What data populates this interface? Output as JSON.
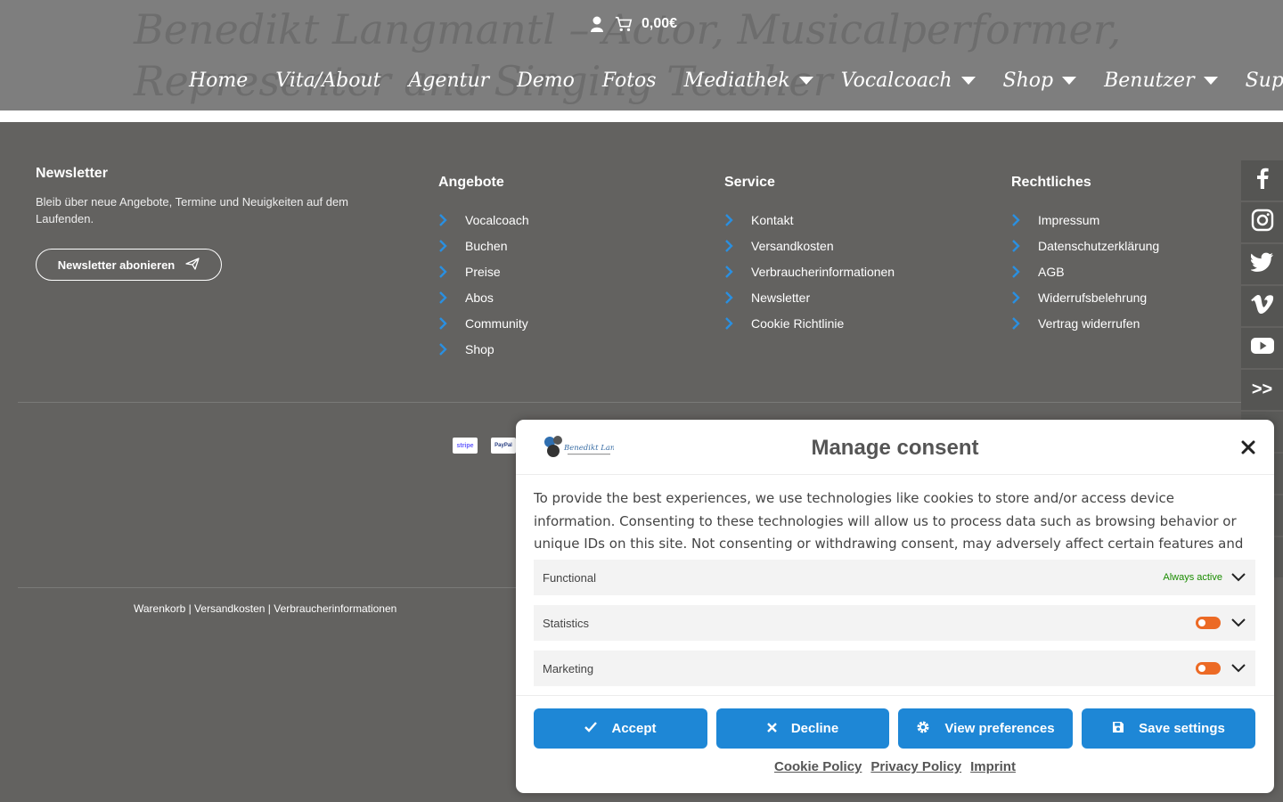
{
  "header": {
    "site_title": "Benedikt Langmantl – Actor, Musicalperformer, Representer and Singing Teacher",
    "cart_total": "0,00€",
    "icons": {
      "user": "user-icon",
      "cart": "cart-icon"
    },
    "nav": [
      {
        "label": "Home",
        "dropdown": false
      },
      {
        "label": "Vita/About",
        "dropdown": false
      },
      {
        "label": "Agentur",
        "dropdown": false
      },
      {
        "label": "Demo",
        "dropdown": false
      },
      {
        "label": "Fotos",
        "dropdown": false
      },
      {
        "label": "Mediathek",
        "dropdown": true
      },
      {
        "label": "Vocalcoach",
        "dropdown": true
      },
      {
        "label": "Shop",
        "dropdown": true
      },
      {
        "label": "Benutzer",
        "dropdown": true
      },
      {
        "label": "Support",
        "dropdown": false
      }
    ]
  },
  "footer": {
    "newsletter": {
      "title": "Newsletter",
      "text": "Bleib über neue Angebote, Termine und Neuigkeiten auf dem Laufenden.",
      "button": "Newsletter abonieren"
    },
    "angebote": {
      "title": "Angebote",
      "links": [
        "Vocalcoach",
        "Buchen",
        "Preise",
        "Abos",
        "Community",
        "Shop"
      ]
    },
    "service": {
      "title": "Service",
      "links": [
        "Kontakt",
        "Versandkosten",
        "Verbraucherinformationen",
        "Newsletter",
        "Cookie Richtlinie"
      ]
    },
    "rechtliches": {
      "title": "Rechtliches",
      "links": [
        "Impressum",
        "Datenschutzerklärung",
        "AGB",
        "Widerrufsbelehrung",
        "Vertrag widerrufen"
      ]
    },
    "payment": [
      "stripe",
      "PayPal"
    ],
    "bottom_links": [
      "Warenkorb",
      "Versandkosten",
      "Verbraucherinformationen"
    ],
    "bottom_separator": " | "
  },
  "social": [
    {
      "name": "facebook-icon"
    },
    {
      "name": "instagram-icon"
    },
    {
      "name": "twitter-icon"
    },
    {
      "name": "vimeo-icon"
    },
    {
      "name": "youtube-icon"
    },
    {
      "name": "more-icon",
      "label": ">>"
    }
  ],
  "consent": {
    "logo_text": "Benedikt Langmantl",
    "title": "Manage consent",
    "body": "To provide the best experiences, we use technologies like cookies to store and/or access device information. Consenting to these technologies will allow us to process data such as browsing behavior or unique IDs on this site. Not consenting or withdrawing consent, may adversely affect certain features and functions.",
    "categories": [
      {
        "label": "Functional",
        "status": "Always active"
      },
      {
        "label": "Statistics",
        "toggle": "off"
      },
      {
        "label": "Marketing",
        "toggle": "off"
      }
    ],
    "buttons": {
      "accept": "Accept",
      "decline": "Decline",
      "view_preferences": "View preferences",
      "save_settings": "Save settings"
    },
    "policy_links": [
      "Cookie Policy",
      "Privacy Policy",
      "Imprint"
    ],
    "colors": {
      "button": "#1e87d6",
      "toggle_off": "#ec6a25",
      "always_active": "#1a8c00"
    }
  }
}
